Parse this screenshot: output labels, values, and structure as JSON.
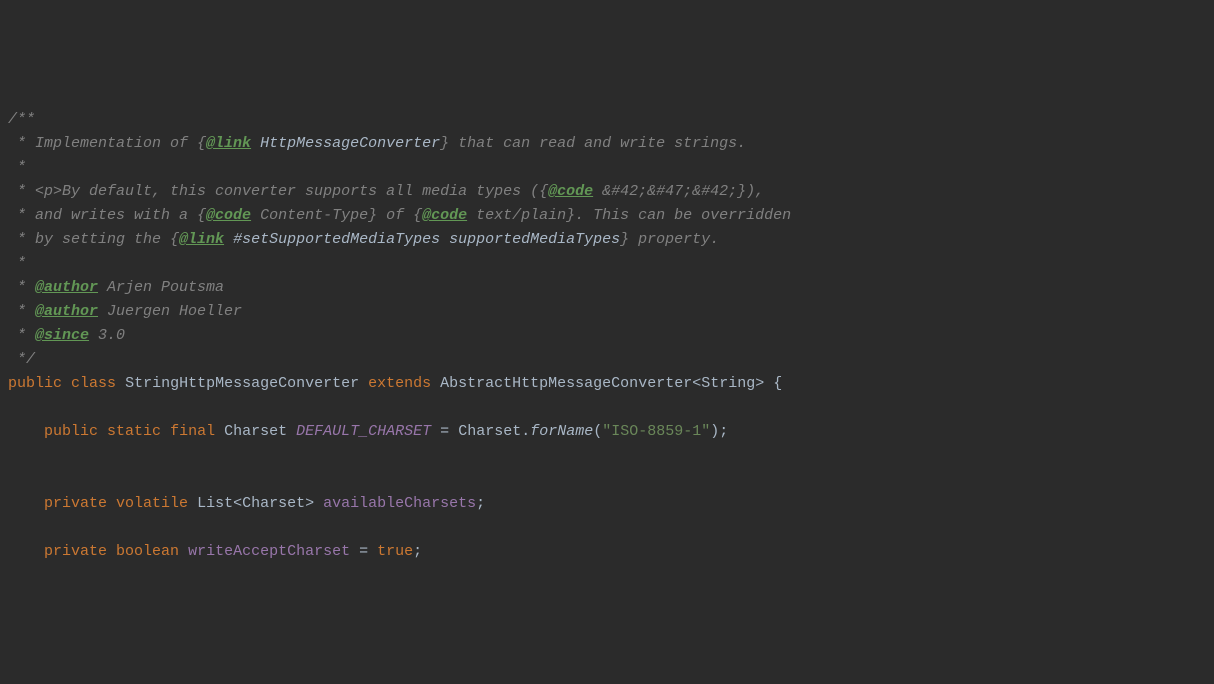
{
  "lines": {
    "l1_start": "/**",
    "l2_prefix": " * ",
    "l2_text1": "Implementation of {",
    "l2_tag": "@link",
    "l2_ref": " HttpMessageConverter",
    "l2_text2": "} that can read and write strings.",
    "l3": " *",
    "l4_prefix": " * ",
    "l4_text1": "<p>By default, this converter supports all media types ({",
    "l4_tag": "@code",
    "l4_text2": " &#42;&#47;&#42;}),",
    "l5_prefix": " * ",
    "l5_text1": "and writes with a {",
    "l5_tag1": "@code",
    "l5_text2": " Content-Type} of {",
    "l5_tag2": "@code",
    "l5_text3": " text/plain}. This can be overridden",
    "l6_prefix": " * ",
    "l6_text1": "by setting the {",
    "l6_tag": "@link",
    "l6_ref": " #setSupportedMediaTypes supportedMediaTypes",
    "l6_text2": "} property.",
    "l7": " *",
    "l8_prefix": " * ",
    "l8_tag": "@author",
    "l8_text": " Arjen Poutsma",
    "l9_prefix": " * ",
    "l9_tag": "@author",
    "l9_text": " Juergen Hoeller",
    "l10_prefix": " * ",
    "l10_tag": "@since",
    "l10_text": " 3.0",
    "l11": " */",
    "l12_kw1": "public",
    "l12_sp1": " ",
    "l12_kw2": "class",
    "l12_sp2": " ",
    "l12_class": "StringHttpMessageConverter",
    "l12_sp3": " ",
    "l12_kw3": "extends",
    "l12_sp4": " ",
    "l12_parent": "AbstractHttpMessageConverter<String> {",
    "l14_indent": "    ",
    "l14_kw1": "public",
    "l14_sp1": " ",
    "l14_kw2": "static",
    "l14_sp2": " ",
    "l14_kw3": "final",
    "l14_sp3": " ",
    "l14_type": "Charset",
    "l14_sp4": " ",
    "l14_name": "DEFAULT_CHARSET",
    "l14_sp5": " = ",
    "l14_call1": "Charset.",
    "l14_method": "forName",
    "l14_paren1": "(",
    "l14_string": "\"ISO-8859-1\"",
    "l14_paren2": ");",
    "l17_indent": "    ",
    "l17_kw1": "private",
    "l17_sp1": " ",
    "l17_kw2": "volatile",
    "l17_sp2": " ",
    "l17_type": "List<Charset>",
    "l17_sp3": " ",
    "l17_name": "availableCharsets",
    "l17_semi": ";",
    "l19_indent": "    ",
    "l19_kw1": "private",
    "l19_sp1": " ",
    "l19_kw2": "boolean",
    "l19_sp2": " ",
    "l19_name": "writeAcceptCharset",
    "l19_sp3": " = ",
    "l19_val": "true",
    "l19_semi": ";"
  }
}
